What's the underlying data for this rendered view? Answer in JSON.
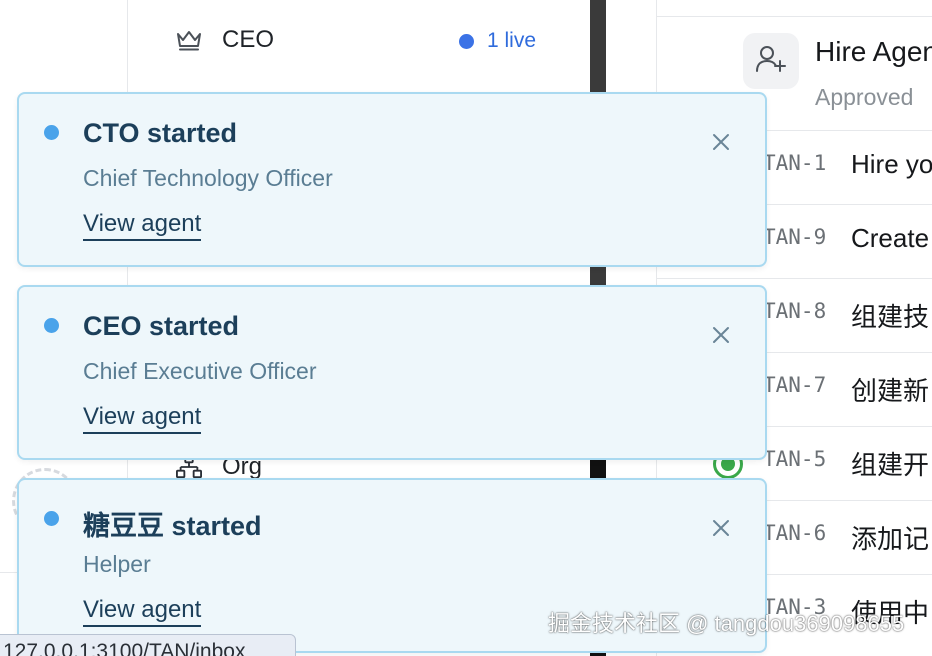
{
  "sidebar": {
    "ceo_item": {
      "label": "CEO",
      "icon": "crown-icon",
      "live_label": "1 live"
    },
    "org_item": {
      "label": "Org",
      "icon": "org-chart-icon"
    }
  },
  "main": {
    "header": {
      "title": "Hire Agen",
      "status": "Approved",
      "icon": "add-user-icon"
    },
    "issues": [
      {
        "id": "TAN-1",
        "title": "Hire yo"
      },
      {
        "id": "TAN-9",
        "title": "Create"
      },
      {
        "id": "TAN-8",
        "title": "组建技"
      },
      {
        "id": "TAN-7",
        "title": "创建新"
      },
      {
        "id": "TAN-5",
        "title": "组建开"
      },
      {
        "id": "TAN-6",
        "title": "添加记"
      },
      {
        "id": "TAN-3",
        "title": "使用中"
      }
    ]
  },
  "toasts": [
    {
      "title": "CTO started",
      "subtitle": "Chief Technology Officer",
      "link": "View agent"
    },
    {
      "title": "CEO started",
      "subtitle": "Chief Executive Officer",
      "link": "View agent"
    },
    {
      "title": "糖豆豆 started",
      "subtitle": "Helper",
      "link": "View agent"
    }
  ],
  "status_url": "127.0.0.1:3100/TAN/inbox",
  "watermark": "掘金技术社区 @ tangdou369098655",
  "colors": {
    "accent": "#3b72e6",
    "toast_bg": "#eef7fb",
    "toast_border": "#a9d9f0",
    "toast_dot": "#4aa3ea",
    "status_done": "#3aa84a"
  }
}
